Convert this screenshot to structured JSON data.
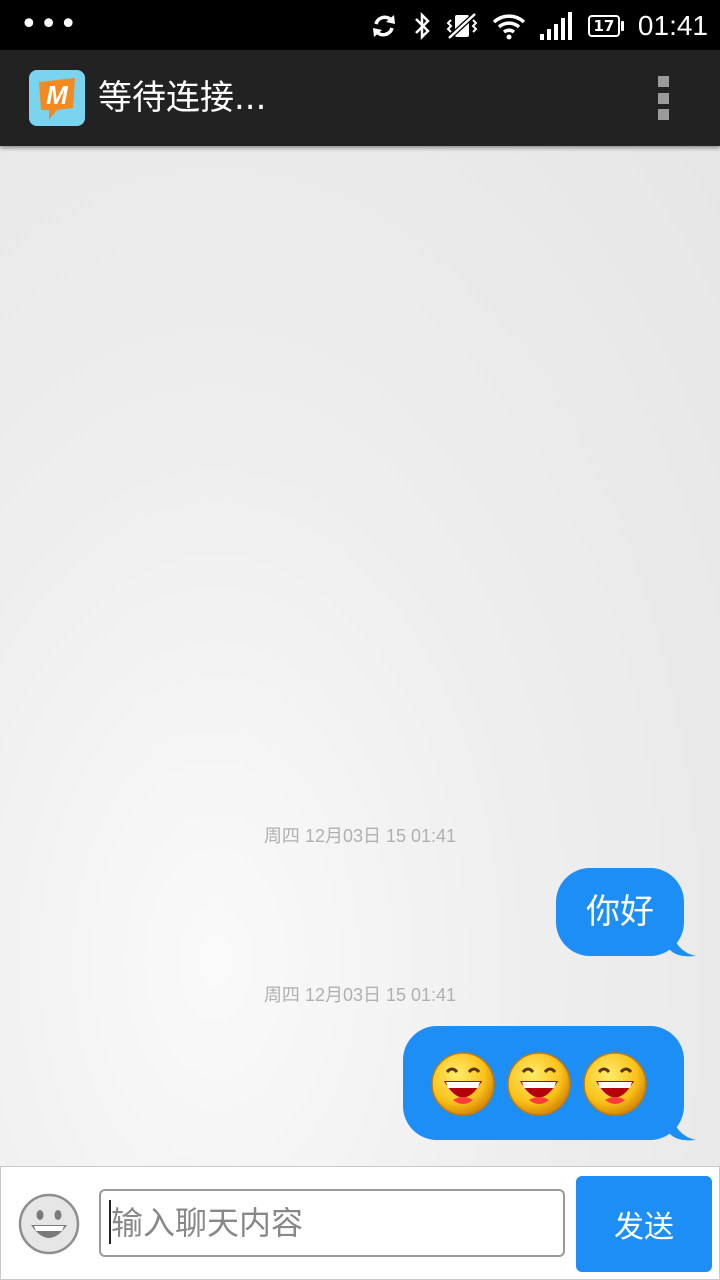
{
  "status_bar": {
    "notification_dots": "•••",
    "battery_level": "17",
    "time": "01:41",
    "icons": [
      "sync-icon",
      "bluetooth-icon",
      "vibrate-off-icon",
      "wifi-icon",
      "signal-icon",
      "battery-icon"
    ]
  },
  "app_bar": {
    "logo_letter": "M",
    "title": "等待连接...",
    "overflow_icon": "overflow-menu-icon"
  },
  "chat": {
    "messages": [
      {
        "timestamp": "周四 12月03日 15 01:41",
        "text": "你好",
        "type": "text"
      },
      {
        "timestamp": "周四 12月03日 15 01:41",
        "type": "emoji",
        "emojis": [
          "grin-emoji",
          "grin-emoji",
          "grin-emoji"
        ]
      }
    ],
    "bubble_color": "#1d8ef6"
  },
  "input_bar": {
    "emoji_button_icon": "smiley-icon",
    "placeholder": "输入聊天内容",
    "value": "",
    "send_label": "发送"
  }
}
